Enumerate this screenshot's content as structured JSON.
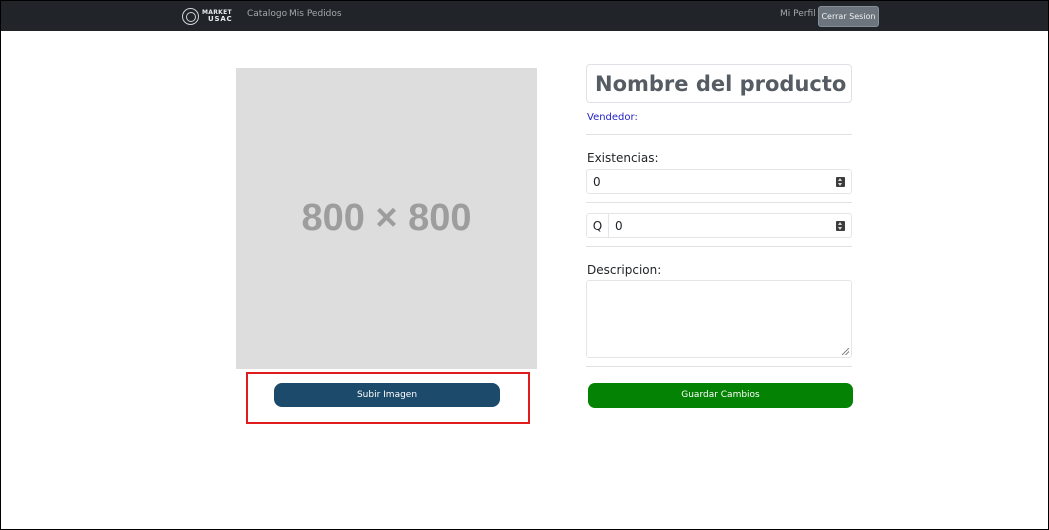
{
  "navbar": {
    "brand": {
      "line1": "MARKET",
      "line2": "USAC"
    },
    "links": [
      {
        "label": "Catalogo"
      },
      {
        "label": "Mis Pedidos"
      }
    ],
    "profile_label": "Mi Perfil",
    "logout_label": "Cerrar Sesion"
  },
  "image": {
    "placeholder_text": "800 × 800",
    "upload_button": "Subir Imagen"
  },
  "form": {
    "product_name": "Nombre del producto",
    "vendor_label": "Vendedor:",
    "stock_label": "Existencias:",
    "stock_value": "0",
    "currency_symbol": "Q",
    "price_value": "0",
    "description_label": "Descripcion:",
    "description_value": "",
    "save_button": "Guardar Cambios"
  },
  "colors": {
    "navbar_bg": "#212529",
    "upload_button_bg": "#1b4a6b",
    "save_button_bg": "#038203",
    "vendor_link": "#2323c8",
    "highlight": "#e01b1b"
  }
}
